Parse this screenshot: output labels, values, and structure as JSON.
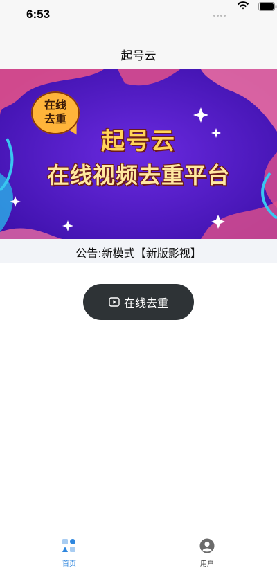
{
  "status_bar": {
    "time": "6:53"
  },
  "header": {
    "title": "起号云"
  },
  "banner": {
    "badge_line1": "在线",
    "badge_line2": "去重",
    "title": "起号云",
    "subtitle": "在线视频去重平台"
  },
  "notice": {
    "text": "公告:新模式【新版影视】"
  },
  "main": {
    "button_label": "在线去重"
  },
  "tabbar": {
    "items": [
      {
        "label": "首页",
        "icon": "home-grid-icon",
        "active": true
      },
      {
        "label": "用户",
        "icon": "user-avatar-icon",
        "active": false
      }
    ],
    "active_color": "#2e86de"
  },
  "colors": {
    "button_bg": "#2e3336",
    "banner_bg": "#4a14c8",
    "banner_title": "#ffd45a"
  }
}
